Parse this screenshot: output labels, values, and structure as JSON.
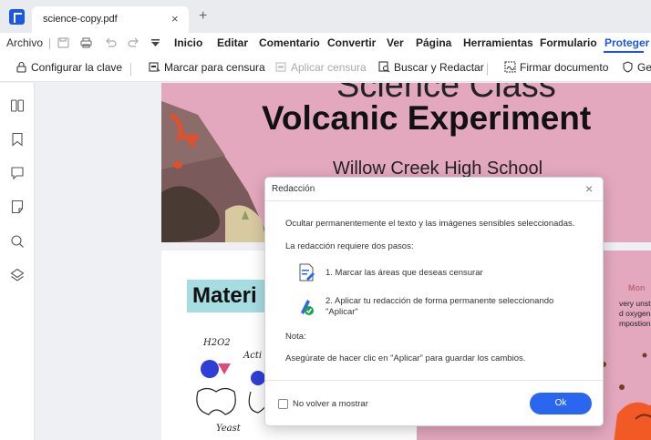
{
  "tab": {
    "title": "science-copy.pdf",
    "close": "×",
    "add": "+"
  },
  "menu": {
    "file": "Archivo",
    "items": [
      "Inicio",
      "Editar",
      "Comentario",
      "Convertir",
      "Ver",
      "Página",
      "Herramientas",
      "Formulario",
      "Proteger"
    ],
    "active": "Proteger"
  },
  "toolbar": {
    "set_password": "Configurar la clave",
    "mark_redaction": "Marcar para censura",
    "apply_redaction": "Aplicar censura",
    "search_redact": "Buscar y Redactar",
    "sign_document": "Firmar documento",
    "cut_off": "Ge"
  },
  "document": {
    "title_partial": "Science Class",
    "title": "Volcanic Experiment",
    "school": "Willow Creek High School",
    "materials_heading": "Materi",
    "hw_h2o2": "H2O2",
    "hw_active": "Acti",
    "hw_yeast": "Yeast",
    "right_heading": "Mon",
    "right_lines": [
      "very unstable",
      "d oxygen gas",
      "mpostion is"
    ]
  },
  "dialog": {
    "title": "Redacción",
    "close": "×",
    "intro": "Ocultar permanentemente el texto y las imágenes sensibles seleccionadas.",
    "two_steps": "La redacción requiere dos pasos:",
    "step1": "1. Marcar las áreas que deseas censurar",
    "step2_line1": "2. Aplicar tu redacción de forma permanente seleccionando",
    "step2_line2": "\"Aplicar\"",
    "note_label": "Nota:",
    "note": "Asegúrate de hacer clic en \"Aplicar\" para guardar los cambios.",
    "dont_show": "No volver a mostrar",
    "ok": "Ok"
  },
  "colors": {
    "accent": "#2b66f0",
    "page_pink": "#e3a8bd",
    "materials_teal": "#a6dde2"
  }
}
